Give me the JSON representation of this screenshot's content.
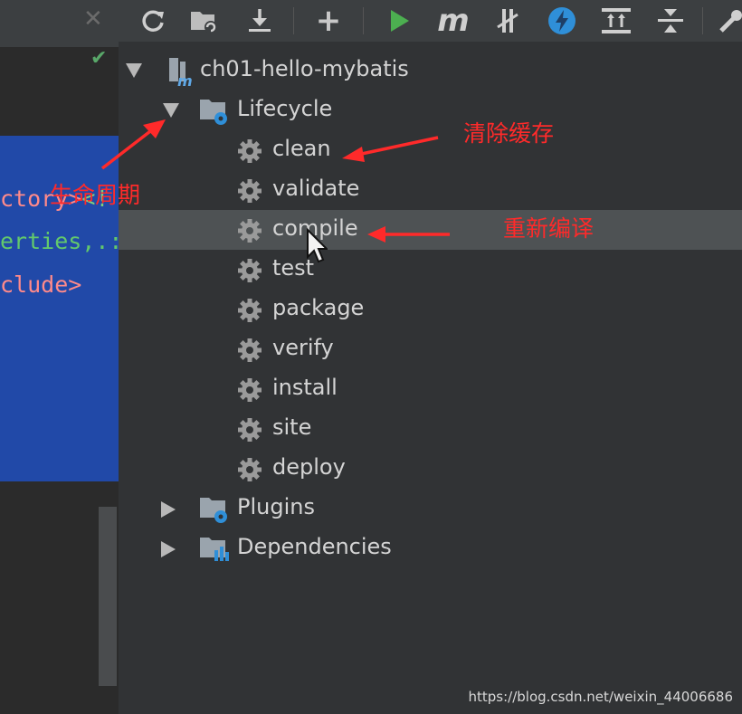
{
  "toolbar": {
    "items": [
      {
        "name": "close-icon",
        "glyph": "✕"
      },
      {
        "name": "reimport-icon"
      },
      {
        "name": "generate-sources-icon"
      },
      {
        "name": "download-icon"
      },
      {
        "name": "add-icon",
        "glyph": "+"
      },
      {
        "name": "run-icon"
      },
      {
        "name": "maven-goal-icon",
        "glyph": "m"
      },
      {
        "name": "toggle-offline-icon"
      },
      {
        "name": "skip-tests-icon"
      },
      {
        "name": "show-dependencies-icon"
      },
      {
        "name": "collapse-all-icon"
      },
      {
        "name": "settings-wrench-icon"
      }
    ]
  },
  "editor": {
    "lines": [
      {
        "prefix": "ctory>",
        "suffix": "<!"
      },
      {
        "prefix": "erties,.:",
        "suffix": ""
      },
      {
        "prefix": "clude>",
        "suffix": ""
      }
    ],
    "check_mark": "✔"
  },
  "tree": {
    "root": {
      "label": "ch01-hello-mybatis",
      "expanded": true
    },
    "lifecycle": {
      "label": "Lifecycle",
      "expanded": true
    },
    "phases": [
      "clean",
      "validate",
      "compile",
      "test",
      "package",
      "verify",
      "install",
      "site",
      "deploy"
    ],
    "selected_phase": "compile",
    "plugins": {
      "label": "Plugins",
      "expanded": false
    },
    "dependencies": {
      "label": "Dependencies",
      "expanded": false
    }
  },
  "annotations": {
    "lifecycle": "生命周期",
    "clean": "清除缓存",
    "compile": "重新编译",
    "color": "#ff2a2a"
  },
  "watermark": "https://blog.csdn.net/weixin_44006686",
  "colors": {
    "tree_bg": "#313335",
    "selection": "#4e5254",
    "code_bg": "#2149a8",
    "run_green": "#4caf50",
    "accent_blue": "#2f8fd8"
  }
}
